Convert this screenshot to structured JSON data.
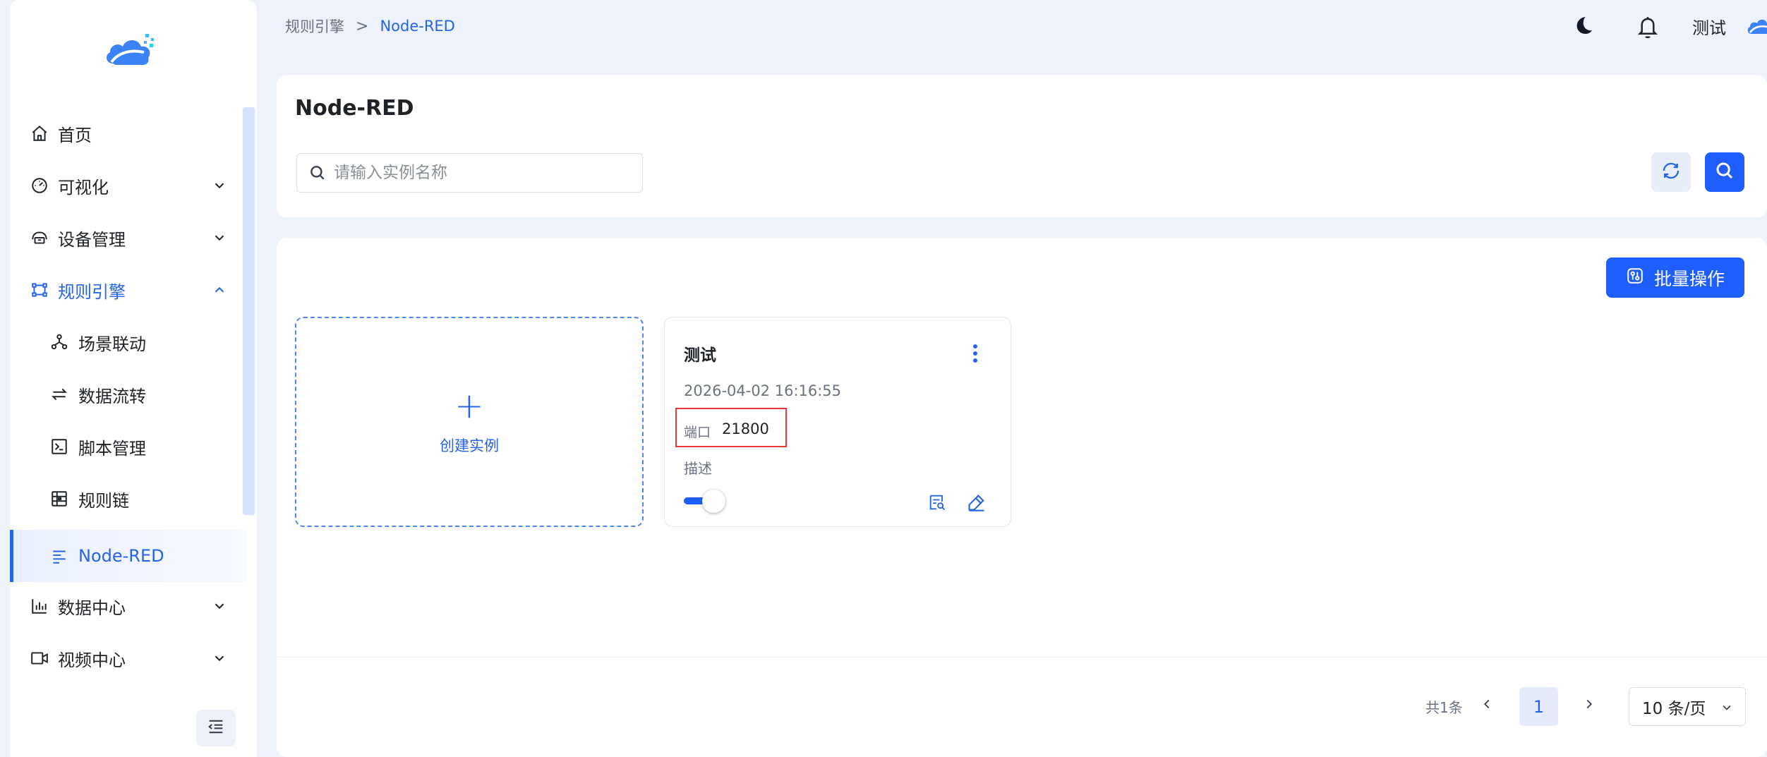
{
  "sidebar": {
    "items": [
      {
        "label": "首页",
        "icon": "home-icon",
        "has_arrow": false,
        "state": "normal"
      },
      {
        "label": "可视化",
        "icon": "dashboard-icon",
        "has_arrow": true,
        "state": "collapsed"
      },
      {
        "label": "设备管理",
        "icon": "device-icon",
        "has_arrow": true,
        "state": "collapsed"
      },
      {
        "label": "规则引擎",
        "icon": "rule-engine-icon",
        "has_arrow": true,
        "state": "expanded"
      },
      {
        "label": "场景联动",
        "icon": "scene-link-icon",
        "sub": true
      },
      {
        "label": "数据流转",
        "icon": "data-flow-icon",
        "sub": true
      },
      {
        "label": "脚本管理",
        "icon": "script-icon",
        "sub": true
      },
      {
        "label": "规则链",
        "icon": "rule-chain-icon",
        "sub": true
      },
      {
        "label": "Node-RED",
        "icon": "node-red-icon",
        "sub": true,
        "state": "active"
      },
      {
        "label": "数据中心",
        "icon": "chart-icon",
        "has_arrow": true,
        "state": "collapsed"
      },
      {
        "label": "视频中心",
        "icon": "video-icon",
        "has_arrow": true,
        "state": "collapsed"
      }
    ]
  },
  "breadcrumb": {
    "parent": "规则引擎",
    "separator": ">",
    "current": "Node-RED"
  },
  "header": {
    "user_name": "测试"
  },
  "page": {
    "title": "Node-RED",
    "search": {
      "placeholder": "请输入实例名称",
      "value": ""
    },
    "batch_label": "批量操作",
    "create_label": "创建实例",
    "create_plus": "+"
  },
  "instances": [
    {
      "name": "测试",
      "date": "2026-04-02 16:16:55",
      "port_label": "端口",
      "port_value": "21800",
      "desc_label": "描述",
      "enabled": true
    }
  ],
  "pagination": {
    "total": "共1条",
    "current_page": "1",
    "page_size": "10 条/页"
  },
  "colors": {
    "primary": "#1e5eff",
    "accent": "#2563eb",
    "highlight_box": "#e53935",
    "background": "#eef3fb"
  }
}
